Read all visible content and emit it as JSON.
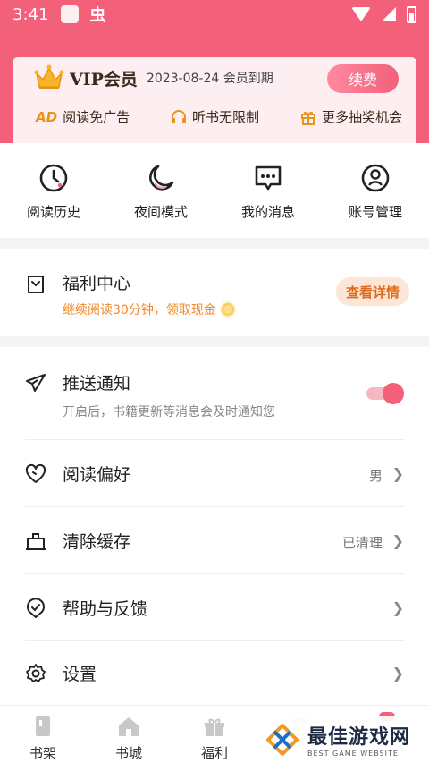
{
  "status_bar": {
    "time": "3:41",
    "glyph": "虫"
  },
  "vip": {
    "title": "VIP会员",
    "expire": "2023-08-24 会员到期",
    "renew_label": "续费",
    "benefits": [
      {
        "icon": "ad",
        "badge": "AD",
        "label": "阅读免广告"
      },
      {
        "icon": "headphones-icon",
        "label": "听书无限制"
      },
      {
        "icon": "gift-icon",
        "label": "更多抽奖机会"
      }
    ]
  },
  "quick_actions": [
    {
      "icon": "clock-icon",
      "label": "阅读历史"
    },
    {
      "icon": "moon-icon",
      "label": "夜间模式"
    },
    {
      "icon": "message-icon",
      "label": "我的消息"
    },
    {
      "icon": "account-icon",
      "label": "账号管理"
    }
  ],
  "welfare": {
    "title": "福利中心",
    "subtitle": "继续阅读30分钟，领取现金",
    "button_label": "查看详情"
  },
  "settings": {
    "push": {
      "label": "推送通知",
      "sub": "开启后，书籍更新等消息会及时通知您",
      "enabled": true
    },
    "preference": {
      "label": "阅读偏好",
      "value": "男"
    },
    "cache": {
      "label": "清除缓存",
      "value": "已清理"
    },
    "help": {
      "label": "帮助与反馈"
    },
    "settings": {
      "label": "设置"
    }
  },
  "tabs": [
    {
      "icon": "bookshelf-icon",
      "label": "书架"
    },
    {
      "icon": "bookstore-icon",
      "label": "书城"
    },
    {
      "icon": "welfare-icon",
      "label": "福利"
    },
    {
      "icon": "category-icon",
      "label": ""
    },
    {
      "icon": "profile-icon",
      "label": ""
    }
  ],
  "watermark": {
    "main": "最佳游戏网",
    "sub": "BEST GAME WEBSITE"
  },
  "colors": {
    "accent": "#f2607a",
    "orange": "#f08a2a",
    "cream": "#fdeef1"
  }
}
